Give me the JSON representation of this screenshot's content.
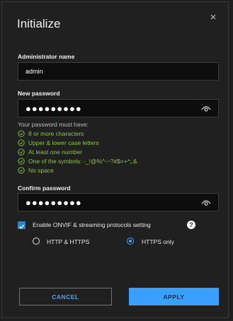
{
  "dialog": {
    "title": "Initialize"
  },
  "admin": {
    "label": "Administrator name",
    "value": "admin"
  },
  "new_password": {
    "label": "New password",
    "masked_value": "●●●●●●●●●"
  },
  "requirements": {
    "title": "Your password must have:",
    "items": [
      "8 or more characters",
      "Upper & lower case letters",
      "At least one number",
      "One of the symbols: -_!@%^-~?#$=+*;,&",
      "No space"
    ],
    "color": "#8dc63f"
  },
  "confirm_password": {
    "label": "Confirm password",
    "masked_value": "●●●●●●●●●"
  },
  "onvif": {
    "label": "Enable ONVIF & streaming protocols setting",
    "checked": true,
    "help": "?"
  },
  "protocol": {
    "options": [
      "HTTP & HTTPS",
      "HTTPS only"
    ],
    "selected": "HTTPS only"
  },
  "actions": {
    "cancel": "CANCEL",
    "apply": "APPLY"
  },
  "colors": {
    "accent": "#3aa0ff",
    "background": "#202020"
  }
}
